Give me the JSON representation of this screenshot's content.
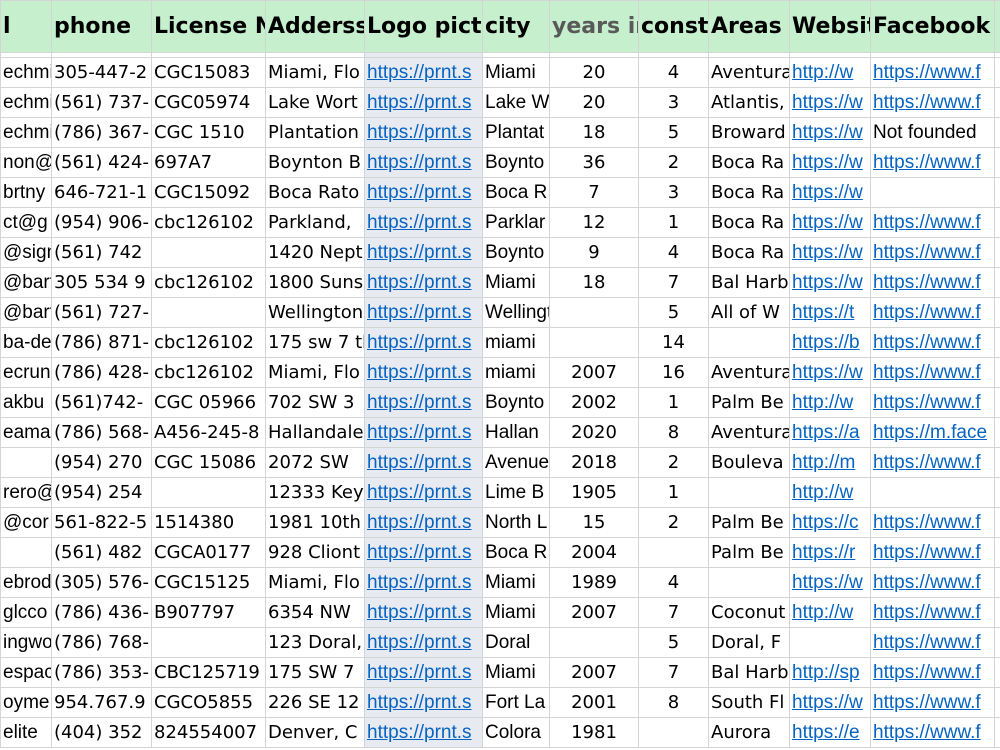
{
  "headers": [
    "l",
    "phone",
    "License Nu",
    "Adderss",
    "Logo pictu",
    "city",
    "years ir",
    "constr",
    "Areas s",
    "Websit",
    "Facebook",
    ""
  ],
  "rows": [
    [
      "echmi",
      "305-447-2",
      " CGC15083",
      "Miami, Flo",
      "https://prnt.s",
      "Miami",
      "20",
      "4",
      "Aventura",
      "http://w",
      "https://www.f",
      ""
    ],
    [
      "echmi",
      "(561) 737-",
      "CGC05974",
      "Lake Wort",
      "https://prnt.s",
      "Lake W",
      "20",
      "3",
      "Atlantis,",
      "https://w",
      "https://www.f",
      ""
    ],
    [
      "echmi",
      "(786) 367-",
      " CGC 1510",
      "Plantation",
      "https://prnt.s",
      "Plantat",
      "18",
      "5",
      "Broward",
      "https://w",
      "Not founded",
      ""
    ],
    [
      "non@",
      "(561) 424-",
      "697A7",
      "Boynton B",
      "https://prnt.s",
      "Boynto",
      "36",
      "2",
      "Boca Ra",
      "https://w",
      "https://www.f",
      ""
    ],
    [
      "brtny",
      "646-721-1",
      "CGC15092",
      "Boca Rato",
      "https://prnt.s",
      "Boca R",
      "7",
      "3",
      "Boca Ra",
      "https://w",
      "",
      ""
    ],
    [
      "ct@g",
      "(954) 906-",
      "cbc126102",
      "Parkland,",
      "https://prnt.s",
      "Parklar",
      "12",
      "1",
      "Boca Ra",
      "https://w",
      "https://www.f",
      ""
    ],
    [
      "@sign",
      " (561) 742",
      "",
      "1420 Nept",
      "https://prnt.s",
      "Boynto",
      "9",
      "4",
      "Boca Ra",
      "https://w",
      "https://www.f",
      ""
    ],
    [
      "@bartr",
      "305 534 9",
      "cbc126102",
      "1800 Suns",
      "https://prnt.s",
      "Miami",
      "18",
      "7",
      "Bal Harb",
      "https://w",
      "https://www.f",
      ""
    ],
    [
      "@bartr",
      "(561) 727-",
      "",
      "Wellington",
      "https://prnt.s",
      "Wellington,",
      "",
      "5",
      "All of W",
      "https://t",
      "https://www.f",
      ""
    ],
    [
      "ba-de",
      "(786) 871-",
      "cbc126102",
      "175 sw 7 th",
      "https://prnt.s",
      " miami",
      "",
      "14",
      "",
      "https://b",
      "https://www.f",
      ""
    ],
    [
      "ecrun",
      "(786) 428-",
      "cbc126102",
      "Miami, Flo",
      "https://prnt.s",
      "miami",
      "2007",
      "16",
      "Aventura",
      "https://w",
      "https://www.f",
      ""
    ],
    [
      "akbu",
      "(561)742-",
      "CGC 05966",
      "702 SW 3",
      "https://prnt.s",
      "Boynto",
      "2002",
      "1",
      "Palm Be",
      "http://w",
      "https://www.f",
      ""
    ],
    [
      "eamar",
      "(786) 568-",
      "A456-245-8",
      "Hallandale",
      "https://prnt.s",
      "Hallan",
      "2020",
      "8",
      "Aventura",
      "https://a",
      "https://m.face",
      ""
    ],
    [
      "",
      " (954) 270",
      "CGC 15086",
      "2072 SW",
      "https://prnt.s",
      "Avenue",
      "2018",
      "2",
      "Bouleva",
      "http://m",
      "https://www.f",
      ""
    ],
    [
      "rero@",
      "(954) 254",
      "",
      "12333 Key",
      "https://prnt.s",
      "Lime B",
      "1905",
      "1",
      "",
      "http://w",
      "",
      ""
    ],
    [
      "@cor",
      "561-822-5",
      "1514380",
      "1981 10th",
      "https://prnt.s",
      "North L",
      "15",
      "2",
      "Palm Be",
      "https://c",
      "https://www.f",
      ""
    ],
    [
      "",
      " (561) 482",
      "CGCA0177",
      "928 Cliont",
      "https://prnt.s",
      "Boca R",
      "2004",
      "",
      "Palm Be",
      "https://r",
      "https://www.f",
      ""
    ],
    [
      "ebrods",
      "(305) 576-",
      "CGC15125",
      "Miami, Flo",
      "https://prnt.s",
      "Miami",
      "1989",
      "4",
      "",
      "https://w",
      "https://www.f",
      ""
    ],
    [
      "glcco",
      "(786) 436-",
      "B907797",
      "6354 NW",
      "https://prnt.s",
      "Miami",
      "2007",
      "7",
      "Coconut",
      "http://w",
      "https://www.f",
      ""
    ],
    [
      "ingwo",
      "(786) 768-",
      "",
      "123 Doral,",
      "https://prnt.s",
      " Doral",
      "",
      "5",
      "Doral, F",
      "",
      "https://www.f",
      ""
    ],
    [
      "espac",
      "(786) 353-",
      "CBC125719",
      "175 SW 7",
      "https://prnt.s",
      "Miami",
      "2007",
      "7",
      "Bal Harb",
      "http://sp",
      "https://www.f",
      ""
    ],
    [
      "oyme",
      "954.767.9",
      "CGCO5855",
      "226 SE 12",
      "https://prnt.s",
      "Fort La",
      "2001",
      "8",
      "South Fl",
      "https://w",
      "https://www.f",
      ""
    ],
    [
      "elite",
      "(404) 352",
      "824554007",
      "Denver, C",
      "https://prnt.s",
      "Colora",
      "1981",
      "",
      "Aurora",
      "https://e",
      "https://www.f",
      ""
    ]
  ]
}
